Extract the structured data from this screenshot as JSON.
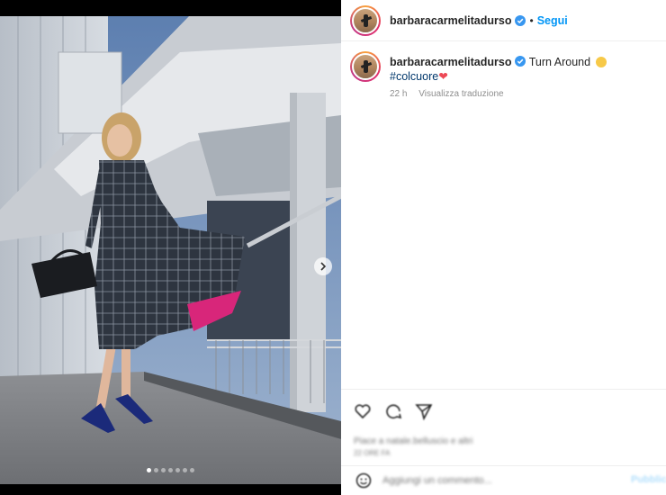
{
  "header": {
    "username": "barbaracarmelitadurso",
    "separator": "•",
    "follow_label": "Segui"
  },
  "caption": {
    "username": "barbaracarmelitadurso",
    "text": "Turn Around",
    "hashtag": "#colcuore",
    "heart": "❤",
    "time": "22 h",
    "translate_label": "Visualizza traduzione"
  },
  "actions": {
    "icons": [
      "heart-icon",
      "comment-icon",
      "share-icon"
    ],
    "likes_text": "Piace a natale.belluscio e altri",
    "date_text": "22 ORE FA"
  },
  "comment": {
    "placeholder": "Aggiungi un commento...",
    "post_label": "Pubblica"
  },
  "carousel": {
    "total_slides": 7,
    "active_index": 0
  },
  "colors": {
    "accent": "#0095f6",
    "hashtag": "#00376b",
    "heart": "#ed4956",
    "verified": "#3897f0"
  }
}
